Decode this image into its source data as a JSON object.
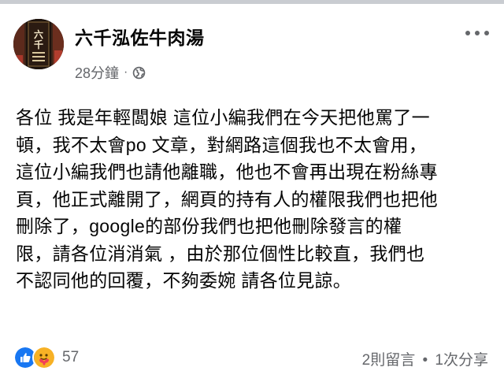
{
  "post": {
    "page_name": "六千泓佐牛肉湯",
    "time": "28分鐘",
    "meta_separator": "·",
    "avatar_text": "六千",
    "privacy_icon": "globe-icon",
    "more_icon": "more-options-icon",
    "body_lines": [
      "各位 我是年輕闆娘 這位小編我們在今天把他罵了一",
      "頓，我不太會po 文章，對網路這個我也不太會用，",
      "這位小編我們也請他離職，他也不會再出現在粉絲專",
      "頁，他正式離開了，網頁的持有人的權限我們也把他",
      "刪除了，google的部份我們也把他刪除發言的權",
      "限，請各位消消氣 ，由於那位個性比較直，我們也",
      "不認同他的回覆，不夠委婉 請各位見諒。"
    ]
  },
  "footer": {
    "reaction_icons": [
      "like-icon",
      "care-icon"
    ],
    "reaction_count": "57",
    "comments": "2則留言",
    "separator": "•",
    "shares": "1次分享"
  },
  "colors": {
    "text": "#050505",
    "secondary_text": "#65676b",
    "like_blue": "#1877f2",
    "care_yellow": "#f7b125",
    "top_border": "#c9ccd1"
  }
}
